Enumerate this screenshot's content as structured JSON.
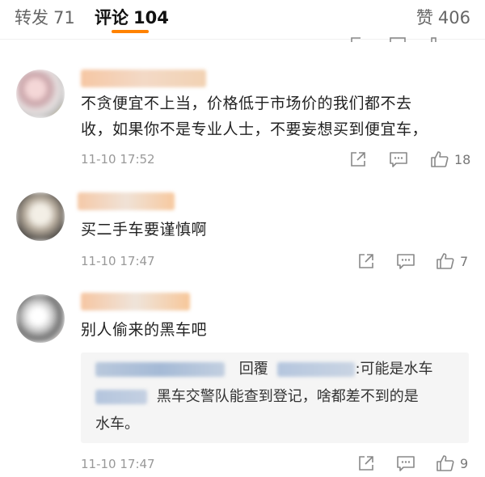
{
  "tabs": {
    "repost_label": "转发",
    "repost_count": "71",
    "comment_label": "评论",
    "comment_count": "104",
    "like_label": "赞",
    "like_count": "406",
    "accent_color": "#ff8200"
  },
  "comments": [
    {
      "text_line1": "不贪便宜不上当，价格低于市场价的我们都不去",
      "text_line2": "收，如果你不是专业人士，不要妄想买到便宜车，",
      "time": "11-10 17:52",
      "like_count": "18",
      "icons": [
        "share-icon",
        "comment-icon",
        "like-icon"
      ]
    },
    {
      "text_line1": "买二手车要谨慎啊",
      "time": "11-10 17:47",
      "like_count": "7",
      "icons": [
        "share-icon",
        "comment-icon",
        "like-icon"
      ]
    },
    {
      "text_line1": "别人偷来的黑车吧",
      "time": "11-10 17:47",
      "like_count": "9",
      "icons": [
        "share-icon",
        "comment-icon",
        "like-icon"
      ],
      "reply": {
        "reply_word": "回覆",
        "line1_tail": ":可能是水车",
        "line2_text": "黑车交警队能查到登记，啥都差不到的是",
        "line3_text": "水车。"
      }
    }
  ]
}
